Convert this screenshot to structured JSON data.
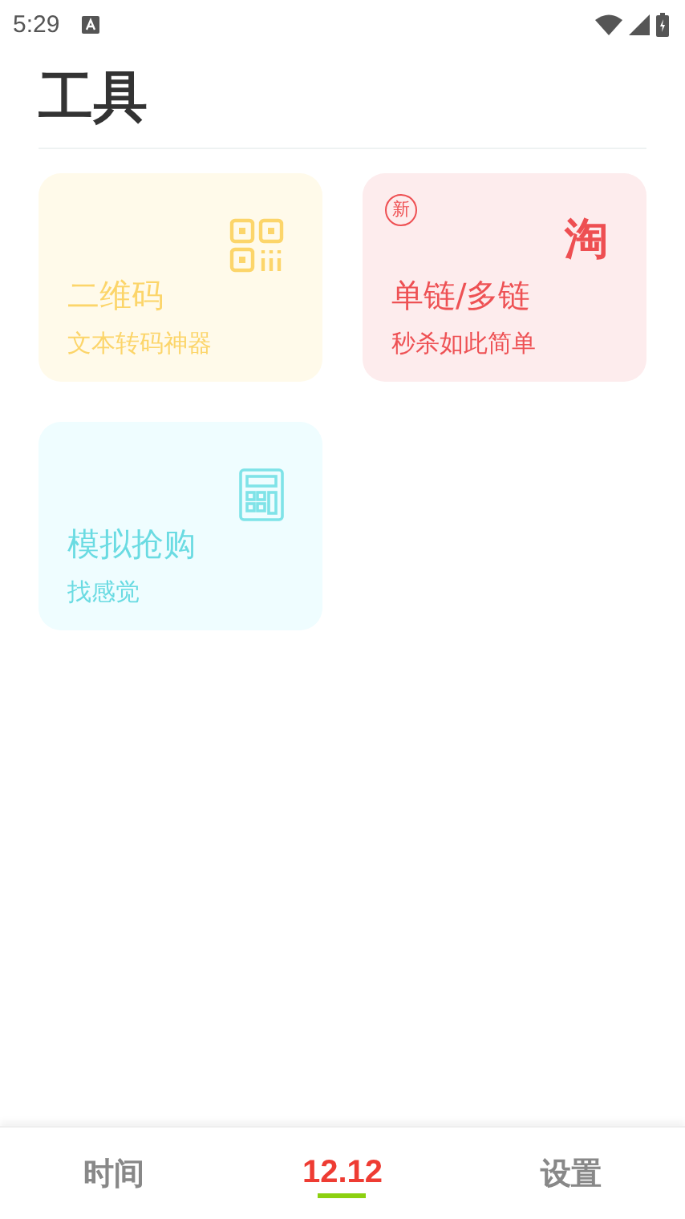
{
  "status_bar": {
    "time": "5:29"
  },
  "title": "工具",
  "cards": [
    {
      "kind": "qr",
      "title": "二维码",
      "subtitle": "文本转码神器"
    },
    {
      "kind": "taobao",
      "title": "单链/多链",
      "subtitle": "秒杀如此简单",
      "badge": "新",
      "logo": "淘"
    },
    {
      "kind": "calculator",
      "title": "模拟抢购",
      "subtitle": "找感觉"
    }
  ],
  "tabs": [
    {
      "label": "时间",
      "selected": false
    },
    {
      "label": "12.12",
      "selected": true
    },
    {
      "label": "设置",
      "selected": false
    }
  ]
}
